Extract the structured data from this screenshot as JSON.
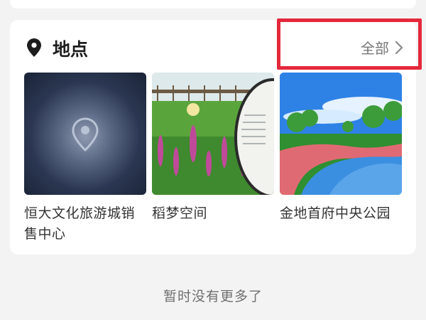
{
  "section": {
    "title": "地点",
    "icon": "location-pin-icon",
    "all_link": {
      "label": "全部",
      "icon": "chevron-right-icon"
    }
  },
  "places": [
    {
      "name": "恒大文化旅游城销售中心",
      "thumbnail": "location-placeholder"
    },
    {
      "name": "稻梦空间",
      "thumbnail": "photo-wetland-flowers"
    },
    {
      "name": "金地首府中央公园",
      "thumbnail": "photo-park-path"
    }
  ],
  "footer": {
    "text": "暂时没有更多了"
  },
  "colors": {
    "highlight": "#e5283c",
    "card": "#ffffff",
    "background": "#f3f3f3"
  }
}
